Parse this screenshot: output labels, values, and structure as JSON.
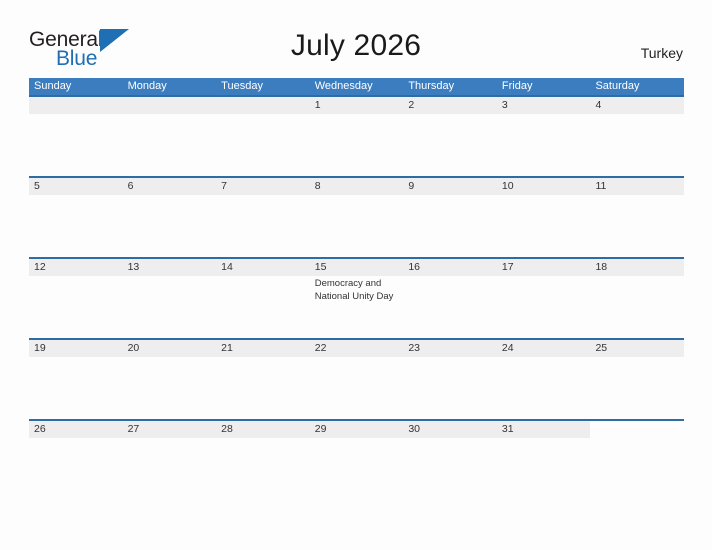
{
  "header": {
    "logo": {
      "word_one": "General",
      "word_two": "Blue",
      "triangle_icon": "triangle-icon"
    },
    "title": "July 2026",
    "region": "Turkey"
  },
  "colors": {
    "header_blue": "#3b7dbf",
    "rule_blue": "#2e6da4",
    "band_gray": "#eeeeee",
    "logo_blue": "#1f6fb5",
    "page_background": "#fdfdfd"
  },
  "calendar": {
    "weekdays": [
      "Sunday",
      "Monday",
      "Tuesday",
      "Wednesday",
      "Thursday",
      "Friday",
      "Saturday"
    ],
    "weeks": [
      {
        "band_columns": 7,
        "days": [
          {
            "number": "",
            "events": []
          },
          {
            "number": "",
            "events": []
          },
          {
            "number": "",
            "events": []
          },
          {
            "number": "1",
            "events": []
          },
          {
            "number": "2",
            "events": []
          },
          {
            "number": "3",
            "events": []
          },
          {
            "number": "4",
            "events": []
          }
        ]
      },
      {
        "band_columns": 7,
        "days": [
          {
            "number": "5",
            "events": []
          },
          {
            "number": "6",
            "events": []
          },
          {
            "number": "7",
            "events": []
          },
          {
            "number": "8",
            "events": []
          },
          {
            "number": "9",
            "events": []
          },
          {
            "number": "10",
            "events": []
          },
          {
            "number": "11",
            "events": []
          }
        ]
      },
      {
        "band_columns": 7,
        "days": [
          {
            "number": "12",
            "events": []
          },
          {
            "number": "13",
            "events": []
          },
          {
            "number": "14",
            "events": []
          },
          {
            "number": "15",
            "events": [
              "Democracy and National Unity Day"
            ]
          },
          {
            "number": "16",
            "events": []
          },
          {
            "number": "17",
            "events": []
          },
          {
            "number": "18",
            "events": []
          }
        ]
      },
      {
        "band_columns": 7,
        "days": [
          {
            "number": "19",
            "events": []
          },
          {
            "number": "20",
            "events": []
          },
          {
            "number": "21",
            "events": []
          },
          {
            "number": "22",
            "events": []
          },
          {
            "number": "23",
            "events": []
          },
          {
            "number": "24",
            "events": []
          },
          {
            "number": "25",
            "events": []
          }
        ]
      },
      {
        "band_columns": 6,
        "days": [
          {
            "number": "26",
            "events": []
          },
          {
            "number": "27",
            "events": []
          },
          {
            "number": "28",
            "events": []
          },
          {
            "number": "29",
            "events": []
          },
          {
            "number": "30",
            "events": []
          },
          {
            "number": "31",
            "events": []
          },
          {
            "number": "",
            "events": []
          }
        ]
      }
    ]
  }
}
